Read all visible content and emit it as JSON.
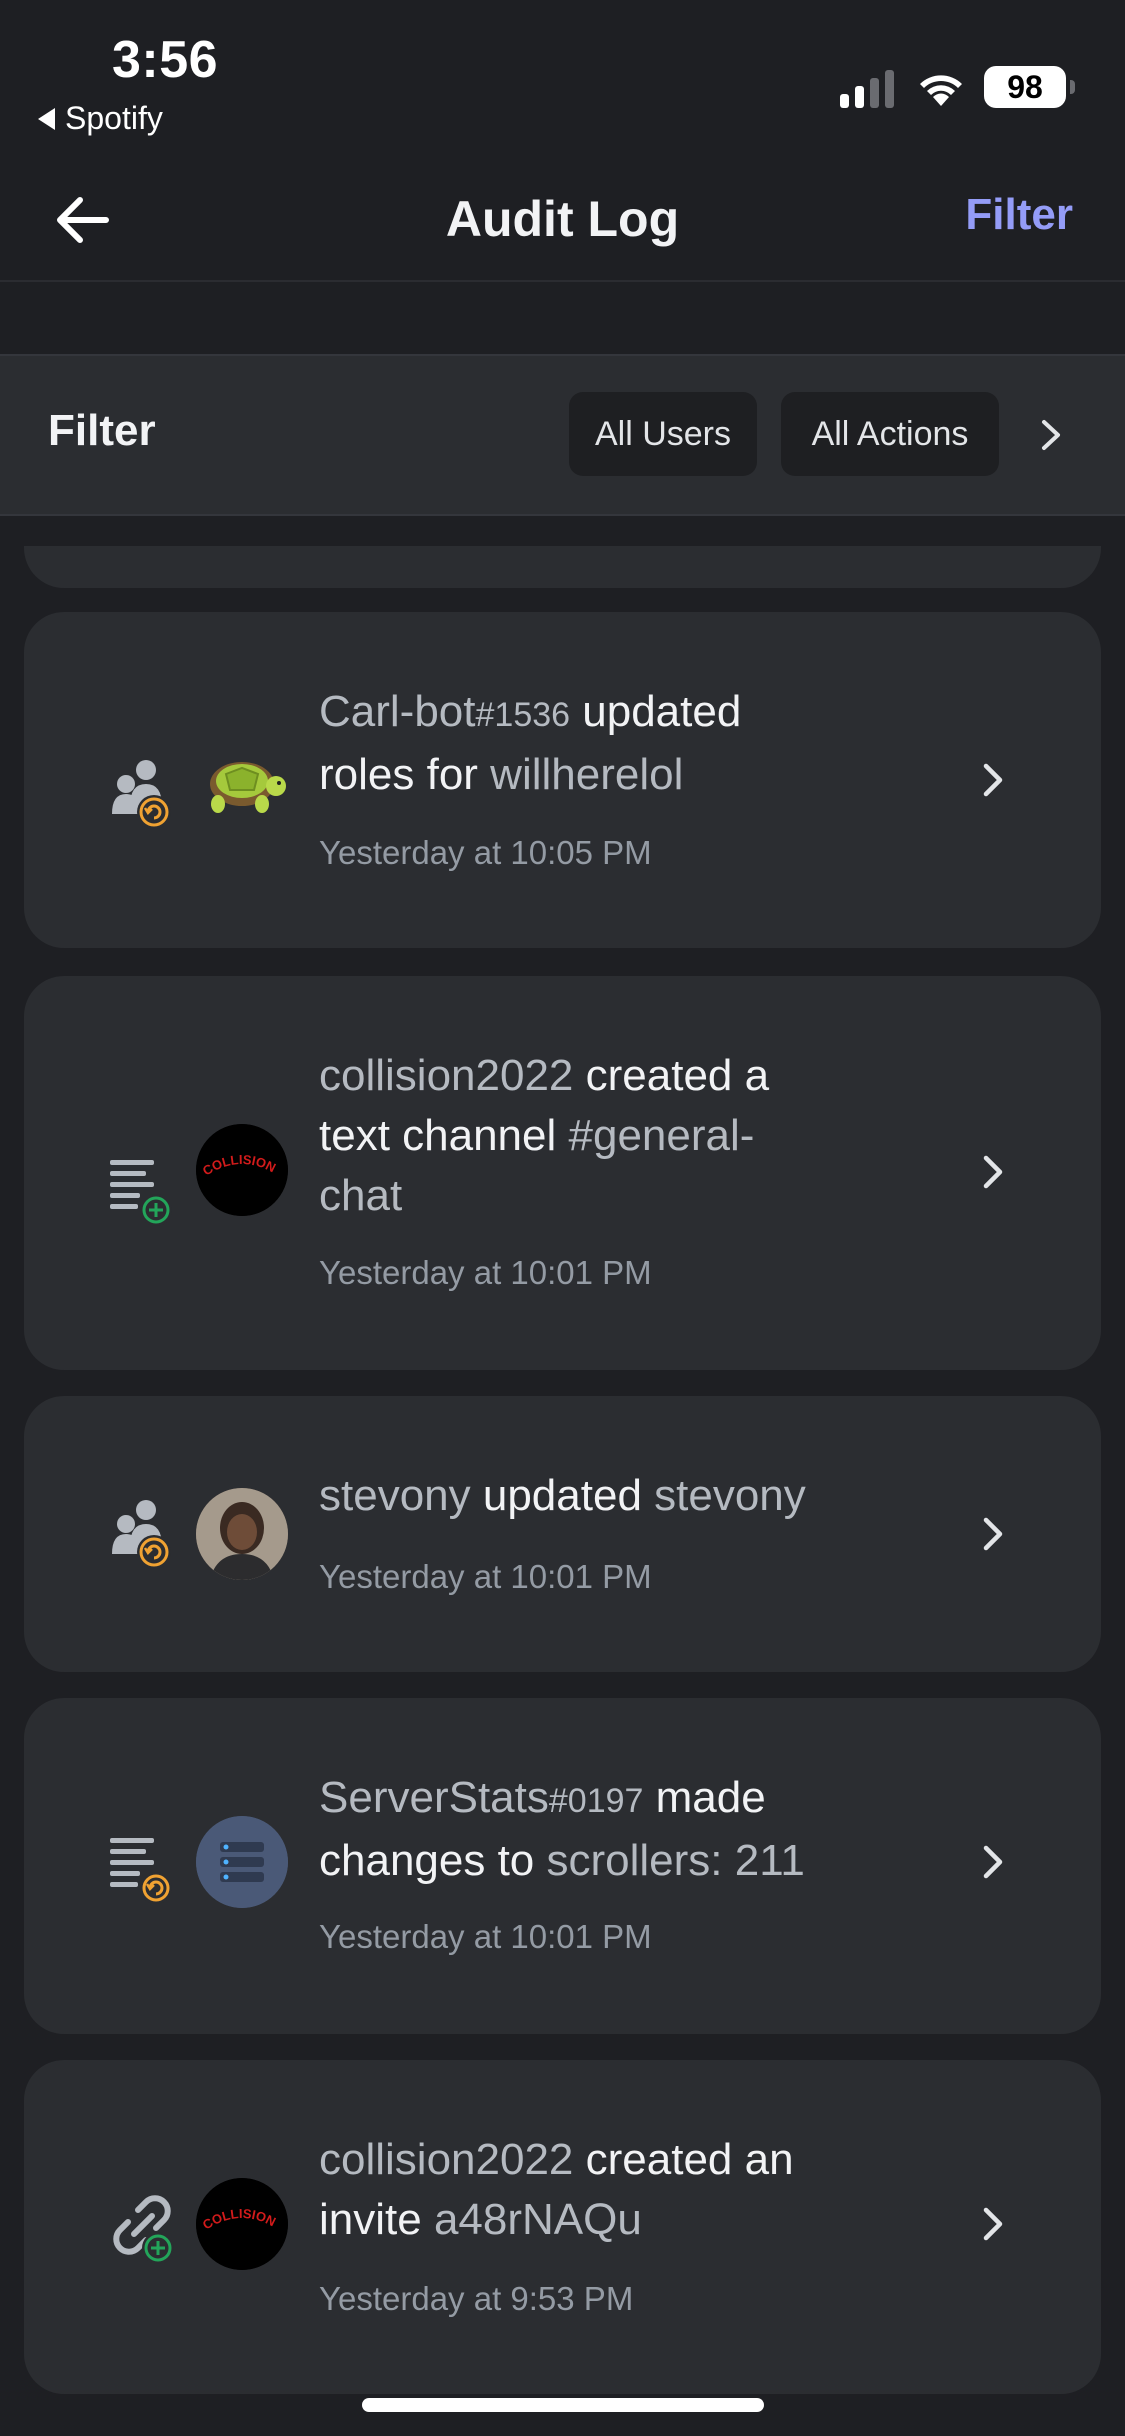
{
  "status_bar": {
    "time": "3:56",
    "back_app": "Spotify",
    "battery": "98"
  },
  "header": {
    "title": "Audit Log",
    "filter_label": "Filter",
    "back_icon": "arrow-left-icon"
  },
  "filter_bar": {
    "label": "Filter",
    "users_chip": "All Users",
    "actions_chip": "All Actions"
  },
  "entries": [
    {
      "icon": "member-role-update-icon",
      "actor": "Carl-bot",
      "actor_tag": "#1536",
      "verb": " updated roles for ",
      "target": "willherelol",
      "target_tail": "",
      "line1_a": "Carl-bot",
      "line1_tag": "#1536",
      "line1_b": " updated",
      "line2_a": "roles for ",
      "line2_b": "willherelol",
      "time": "Yesterday at 10:05 PM"
    },
    {
      "icon": "channel-create-icon",
      "line1_a": "collision2022",
      "line1_b": " created a",
      "line2_a": "text channel ",
      "line2_b": "#general-",
      "line3": "chat",
      "time": "Yesterday at 10:01 PM"
    },
    {
      "icon": "member-update-icon",
      "line1_a": "stevony",
      "line1_b": " updated ",
      "line1_c": "stevony",
      "time": "Yesterday at 10:01 PM"
    },
    {
      "icon": "channel-update-icon",
      "line1_a": "ServerStats",
      "line1_tag": "#0197",
      "line1_b": " made",
      "line2_a": "changes to ",
      "line2_b": "scrollers",
      "line2_c": ": 211",
      "time": "Yesterday at 10:01 PM"
    },
    {
      "icon": "invite-create-icon",
      "line1_a": "collision2022",
      "line1_b": " created an",
      "line2_a": "invite ",
      "line2_b": "a48rNAQu",
      "time": "Yesterday at 9:53 PM"
    }
  ],
  "colors": {
    "accent": "#949cf7",
    "background": "#1e1f23",
    "card": "#2b2d31",
    "badge_orange": "#f0a232",
    "badge_green": "#23a55a"
  }
}
